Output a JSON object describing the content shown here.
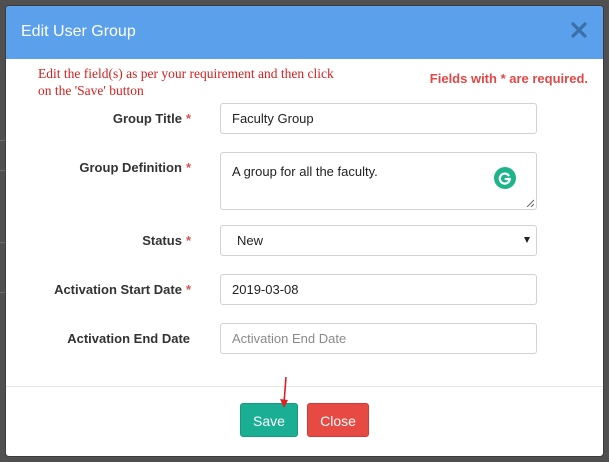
{
  "modal": {
    "title": "Edit User Group",
    "close_icon": "close-icon",
    "instruction": "Edit the field(s) as per your requirement and then click on the 'Save' button",
    "required_note": "Fields with * are required.",
    "required_marker": "*"
  },
  "form": {
    "group_title": {
      "label": "Group Title",
      "value": "Faculty Group",
      "required": true
    },
    "group_definition": {
      "label": "Group Definition",
      "value": "A group for all the faculty.",
      "required": true,
      "assistant_icon": "grammarly-icon"
    },
    "status": {
      "label": "Status",
      "value": "New",
      "required": true
    },
    "activation_start_date": {
      "label": "Activation Start Date",
      "value": "2019-03-08",
      "required": true
    },
    "activation_end_date": {
      "label": "Activation End Date",
      "value": "",
      "placeholder": "Activation End Date",
      "required": false
    }
  },
  "buttons": {
    "save": "Save",
    "close": "Close"
  },
  "colors": {
    "header": "#5aa0ea",
    "save": "#1aaf94",
    "close": "#e64a42",
    "required": "#d9534f",
    "instruction": "#d42020"
  }
}
